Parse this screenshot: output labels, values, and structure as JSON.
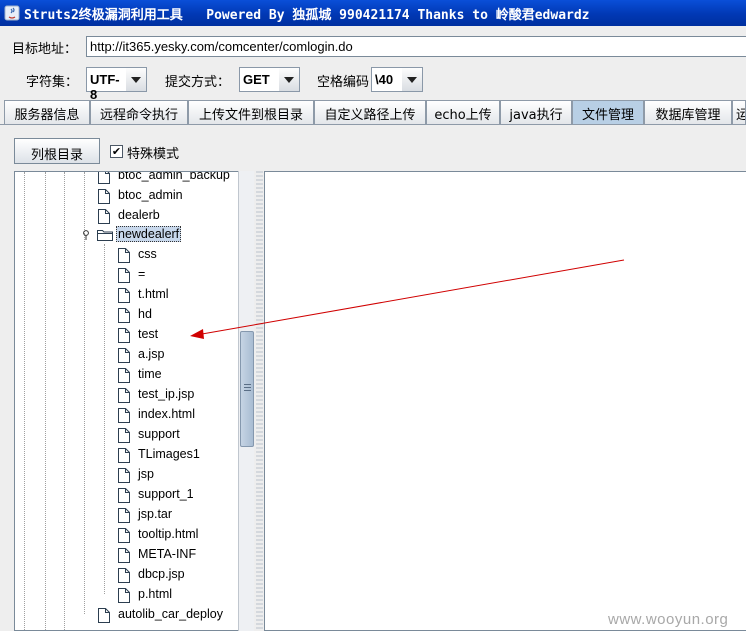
{
  "window": {
    "title": "Struts2终极漏洞利用工具   Powered By 独孤城 990421174 Thanks to 岭酸君edwardz"
  },
  "form": {
    "target_label": "目标地址：",
    "target_value": "http://it365.yesky.com/comcenter/comlogin.do",
    "charset_label": "字符集：",
    "charset_value": "UTF-8",
    "method_label": "提交方式：",
    "method_value": "GET",
    "space_label": "空格编码",
    "space_value": "\\40"
  },
  "tabs": [
    {
      "label": "服务器信息"
    },
    {
      "label": "远程命令执行"
    },
    {
      "label": "上传文件到根目录"
    },
    {
      "label": "自定义路径上传"
    },
    {
      "label": "echo上传"
    },
    {
      "label": "java执行"
    },
    {
      "label": "文件管理"
    },
    {
      "label": "数据库管理"
    },
    {
      "label": "运"
    }
  ],
  "file_manager": {
    "list_root_button": "列根目录",
    "special_mode_label": "特殊模式",
    "special_mode_checked": true
  },
  "tree": {
    "top_items": [
      {
        "name": "btoc_admin_backup"
      },
      {
        "name": "btoc_admin"
      },
      {
        "name": "dealerb"
      }
    ],
    "expanded_folder": "newdealerf",
    "children": [
      {
        "name": "css"
      },
      {
        "name": "="
      },
      {
        "name": "t.html"
      },
      {
        "name": "hd"
      },
      {
        "name": "test"
      },
      {
        "name": "a.jsp"
      },
      {
        "name": "time"
      },
      {
        "name": "test_ip.jsp"
      },
      {
        "name": "index.html"
      },
      {
        "name": "support"
      },
      {
        "name": "TLimages1"
      },
      {
        "name": "jsp"
      },
      {
        "name": "support_1"
      },
      {
        "name": "jsp.tar"
      },
      {
        "name": "tooltip.html"
      },
      {
        "name": "META-INF"
      },
      {
        "name": "dbcp.jsp"
      },
      {
        "name": "p.html"
      }
    ],
    "bottom_items": [
      {
        "name": "autolib_car_deploy"
      }
    ]
  },
  "annotation_color": "#d00000",
  "watermark": "www.wooyun.org"
}
